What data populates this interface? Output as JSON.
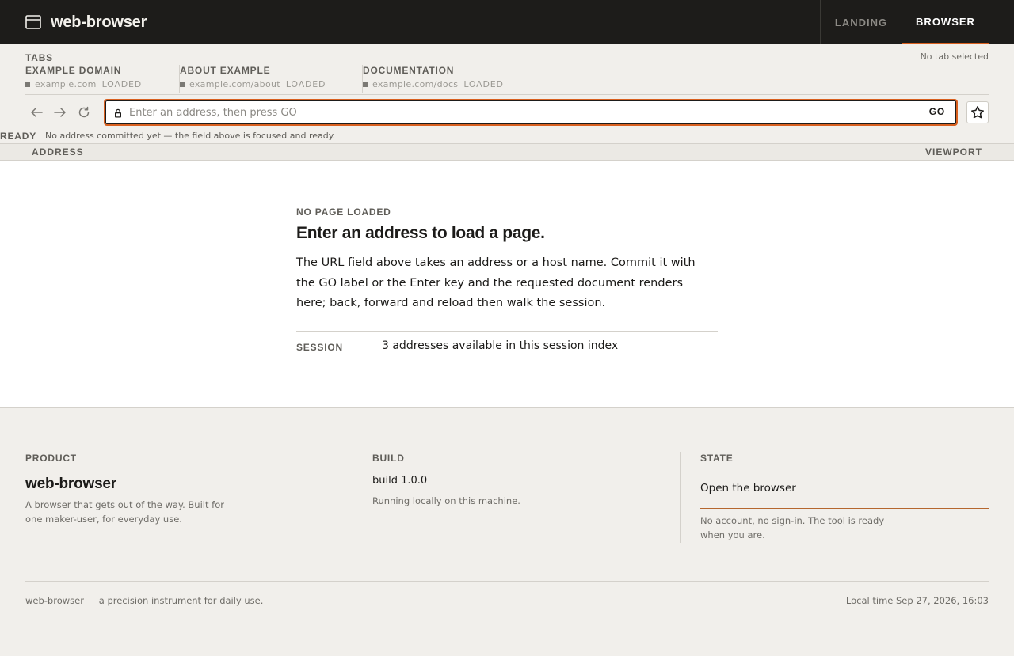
{
  "app": {
    "name": "web-browser",
    "nav": {
      "landing": "LANDING",
      "browser": "BROWSER"
    }
  },
  "tabs": {
    "heading": "TABS",
    "status": "No tab selected",
    "items": [
      {
        "title": "EXAMPLE DOMAIN",
        "url": "example.com",
        "state": "LOADED"
      },
      {
        "title": "ABOUT EXAMPLE",
        "url": "example.com/about",
        "state": "LOADED"
      },
      {
        "title": "DOCUMENTATION",
        "url": "example.com/docs",
        "state": "LOADED"
      }
    ]
  },
  "toolbar": {
    "placeholder": "Enter an address, then press GO",
    "value": "",
    "go_label": "GO",
    "icons": [
      "back-arrow-icon",
      "forward-arrow-icon",
      "reload-icon",
      "lock-icon",
      "star-icon"
    ]
  },
  "status": {
    "label": "READY",
    "text": "No address committed yet — the field above is focused and ready."
  },
  "labels": {
    "left": "ADDRESS",
    "right": "VIEWPORT"
  },
  "viewport": {
    "eyebrow": "NO PAGE LOADED",
    "title": "Enter an address to load a page.",
    "body": "The URL field above takes an address or a host name. Commit it with the GO label or the Enter key and the requested document renders here; back, forward and reload then walk the session.",
    "session_key": "SESSION",
    "session_value": "3 addresses available in this session index"
  },
  "footer": {
    "product": {
      "heading": "PRODUCT",
      "name": "web-browser",
      "desc_line1": "A browser that gets out of the way. Built for",
      "desc_line2": "one maker-user, for everyday use."
    },
    "build": {
      "heading": "BUILD",
      "version": "build 1.0.0",
      "desc": "Running locally on this machine."
    },
    "state": {
      "heading": "STATE",
      "action": "Open the browser",
      "desc_line1": "No account, no sign-in. The tool is ready",
      "desc_line2": "when you are."
    },
    "tagline": "web-browser — a precision instrument for daily use.",
    "local_time": "Local time Sep 27, 2026, 16:03"
  },
  "colors": {
    "accent": "#d9601f",
    "topbar": "#1d1c1a",
    "background": "#f1efeb"
  }
}
